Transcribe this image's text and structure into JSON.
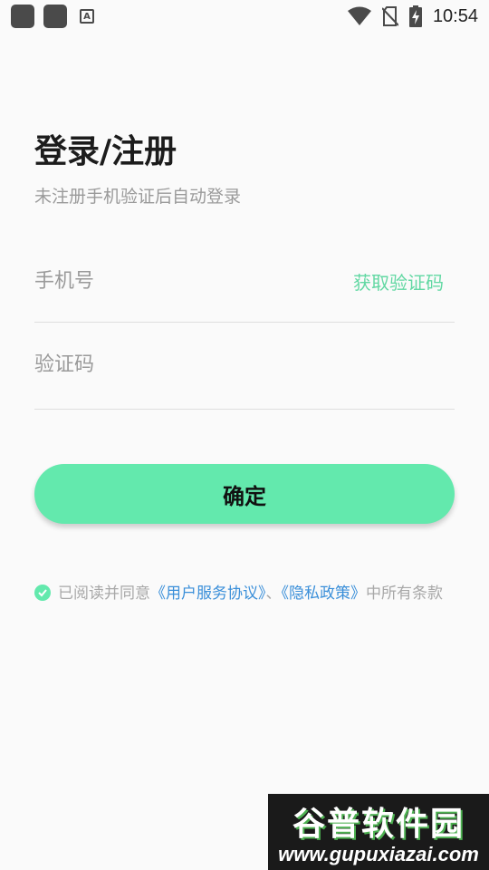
{
  "status_bar": {
    "time": "10:54",
    "notification_icon": "A",
    "icons": [
      "app-icon",
      "app-icon",
      "text-icon",
      "wifi-icon",
      "no-sim-icon",
      "battery-charging-icon"
    ]
  },
  "page": {
    "title": "登录/注册",
    "subtitle": "未注册手机验证后自动登录"
  },
  "form": {
    "phone_placeholder": "手机号",
    "get_code_label": "获取验证码",
    "code_placeholder": "验证码",
    "confirm_label": "确定"
  },
  "agreement": {
    "prefix": "已阅读并同意",
    "service_link": "《用户服务协议》",
    "separator": "、",
    "privacy_link": "《隐私政策》",
    "suffix": "中所有条款",
    "checked": true
  },
  "watermark": {
    "title": "谷普软件园",
    "url": "www.gupuxiazai.com"
  },
  "colors": {
    "accent": "#63e9ad",
    "link": "#3a8fd9",
    "background": "#fafafa"
  }
}
